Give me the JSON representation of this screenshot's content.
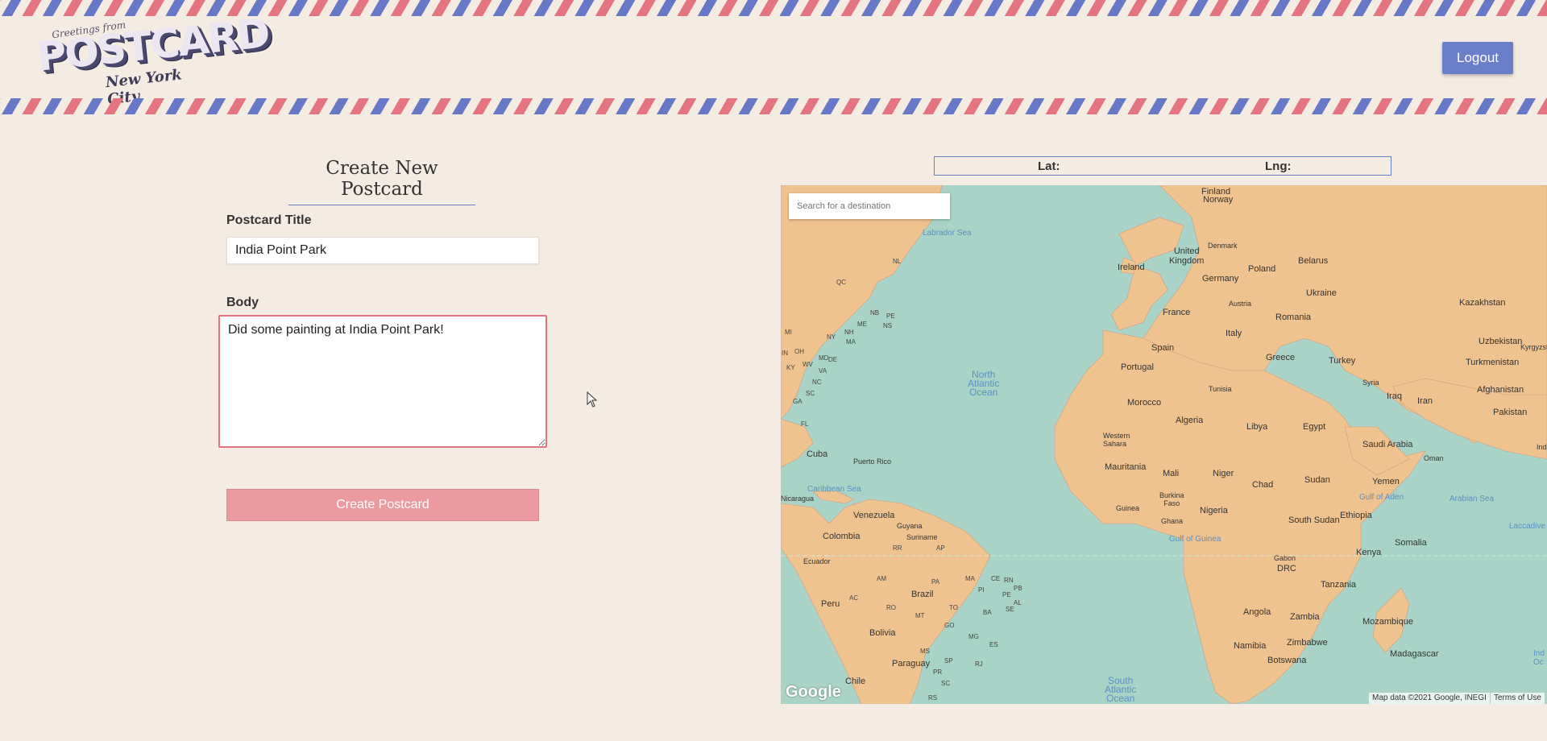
{
  "header": {
    "logo": {
      "greeting": "Greetings from",
      "name": "POSTCARD",
      "city": "New York City"
    },
    "logout_label": "Logout"
  },
  "form": {
    "heading": "Create New Postcard",
    "title_label": "Postcard Title",
    "title_value": "India Point Park",
    "body_label": "Body",
    "body_value": "Did some painting at India Point Park!",
    "submit_label": "Create Postcard"
  },
  "coords": {
    "lat_label": "Lat:",
    "lng_label": "Lng:"
  },
  "map": {
    "search_placeholder": "Search for a destination",
    "google_label": "Google",
    "attribution": "Map data ©2021 Google, INEGI",
    "terms": "Terms of Use",
    "labels": {
      "north_atlantic": "North\nAtlantic\nOcean",
      "south_atlantic": "South\nAtlantic\nOcean",
      "labrador_sea": "Labrador Sea",
      "caribbean_sea": "Caribbean Sea",
      "gulf_of_guinea": "Gulf of Guinea",
      "gulf_of_aden": "Gulf of Aden",
      "arabian_sea": "Arabian Sea",
      "finland": "Finland",
      "norway": "Norway",
      "denmark": "Denmark",
      "united_kingdom": "United\nKingdom",
      "ireland": "Ireland",
      "poland": "Poland",
      "belarus": "Belarus",
      "germany": "Germany",
      "ukraine": "Ukraine",
      "kazakhstan": "Kazakhstan",
      "france": "France",
      "austria": "Austria",
      "romania": "Romania",
      "italy": "Italy",
      "spain": "Spain",
      "portugal": "Portugal",
      "greece": "Greece",
      "turkey": "Turkey",
      "uzbekistan": "Uzbekistan",
      "kyrgyzstan": "Kyrgyzstan",
      "turkmenistan": "Turkmenistan",
      "syria": "Syria",
      "iraq": "Iraq",
      "iran": "Iran",
      "afghanistan": "Afghanistan",
      "pakistan": "Pakistan",
      "tunisia": "Tunisia",
      "morocco": "Morocco",
      "algeria": "Algeria",
      "libya": "Libya",
      "egypt": "Egypt",
      "saudi_arabia": "Saudi Arabia",
      "oman": "Oman",
      "western_sahara": "Western\nSahara",
      "mauritania": "Mauritania",
      "mali": "Mali",
      "niger": "Niger",
      "chad": "Chad",
      "sudan": "Sudan",
      "yemen": "Yemen",
      "burkina_faso": "Burkina\nFaso",
      "guinea": "Guinea",
      "ghana": "Ghana",
      "nigeria": "Nigeria",
      "south_sudan": "South Sudan",
      "ethiopia": "Ethiopia",
      "somalia": "Somalia",
      "kenya": "Kenya",
      "gabon": "Gabon",
      "drc": "DRC",
      "tanzania": "Tanzania",
      "angola": "Angola",
      "zambia": "Zambia",
      "mozambique": "Mozambique",
      "namibia": "Namibia",
      "zimbabwe": "Zimbabwe",
      "botswana": "Botswana",
      "madagascar": "Madagascar",
      "cuba": "Cuba",
      "puerto_rico": "Puerto Rico",
      "nicaragua": "Nicaragua",
      "venezuela": "Venezuela",
      "guyana": "Guyana",
      "suriname": "Suriname",
      "colombia": "Colombia",
      "ecuador": "Ecuador",
      "peru": "Peru",
      "brazil": "Brazil",
      "bolivia": "Bolivia",
      "paraguay": "Paraguay",
      "chile": "Chile",
      "nl": "NL",
      "qc": "QC",
      "nb": "NB",
      "pe": "PE",
      "ns": "NS",
      "me": "ME",
      "nh": "NH",
      "ma": "MA",
      "ny": "NY",
      "mi": "MI",
      "oh": "OH",
      "md": "MD",
      "wv": "WV",
      "va": "VA",
      "ky": "KY",
      "nc": "NC",
      "sc": "SC",
      "ga": "GA",
      "fl": "FL",
      "de": "DE",
      "in": "IN",
      "rr": "RR",
      "ap": "AP",
      "am": "AM",
      "pa": "PA",
      "ma_br": "MA",
      "ce": "CE",
      "rn": "RN",
      "pb": "PB",
      "pe_br": "PE",
      "al": "AL",
      "pi": "PI",
      "ac": "AC",
      "ro": "RO",
      "to": "TO",
      "ba": "BA",
      "se": "SE",
      "mt": "MT",
      "go": "GO",
      "mg": "MG",
      "es": "ES",
      "ms": "MS",
      "sp": "SP",
      "rj": "RJ",
      "pr": "PR",
      "sc_br": "SC",
      "rs": "RS",
      "ind_top": "Ind",
      "laccadive": "Laccadive",
      "ind_bottom": "Ind\nOc"
    }
  }
}
